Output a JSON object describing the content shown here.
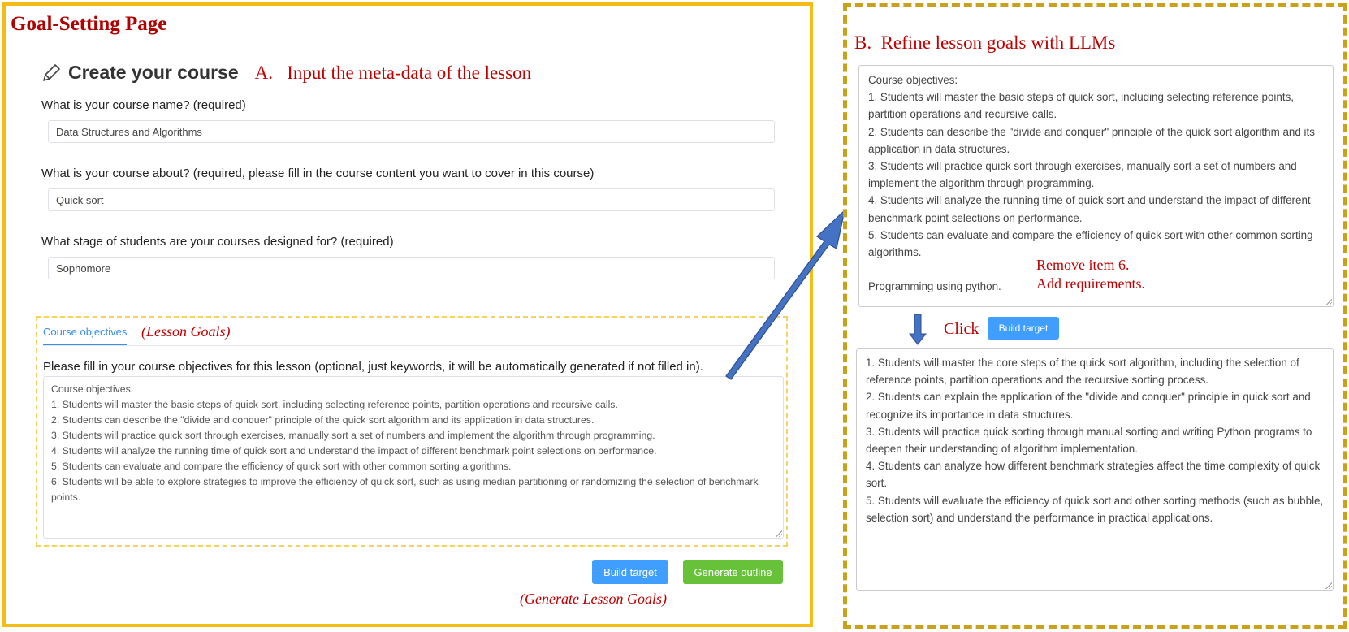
{
  "left": {
    "page_title": "Goal-Setting Page",
    "create_title": "Create your course",
    "annotation_a": "A.   Input the meta-data of the lesson",
    "fields": [
      {
        "label": "What is your course name? (required)",
        "value": "Data Structures and Algorithms"
      },
      {
        "label": "What is your course about? (required, please fill in the course content you want to cover in this course)",
        "value": "Quick sort"
      },
      {
        "label": "What stage of students are your courses designed for? (required)",
        "value": "Sophomore"
      }
    ],
    "tab_label": "Course objectives",
    "annotation_lesson_goals": "(Lesson Goals)",
    "fill_label": "Please fill in your course objectives for this lesson (optional, just keywords, it will be automatically generated if not filled in).",
    "objectives": [
      "Course objectives:",
      "1. Students will master the basic steps of quick sort, including selecting reference points, partition operations and recursive calls.",
      "2. Students can describe the \"divide and conquer\" principle of the quick sort algorithm and its application in data structures.",
      "3. Students will practice quick sort through exercises, manually sort a set of numbers and implement the algorithm through programming.",
      "4. Students will analyze the running time of quick sort and understand the impact of different benchmark point selections on performance.",
      "5. Students can evaluate and compare the efficiency of quick sort with other common sorting algorithms.",
      "6. Students will be able to explore strategies to improve the efficiency of quick sort, such as using median partitioning or randomizing the selection of benchmark points."
    ],
    "build_target_label": "Build target",
    "generate_outline_label": "Generate outline",
    "annotation_generate": "(Generate Lesson Goals)"
  },
  "right": {
    "annotation_b": "B.  Refine lesson goals with LLMs",
    "input_lines": [
      "Course objectives:",
      "1. Students will master the basic steps of quick sort, including selecting reference points, partition operations and recursive calls.",
      "2. Students can describe the \"divide and conquer\" principle of the quick sort algorithm and its application in data structures.",
      "3. Students will practice quick sort through exercises, manually sort a set of numbers and implement the algorithm through programming.",
      "4. Students will analyze the running time of quick sort and understand the impact of different benchmark point selections on performance.",
      "5. Students can evaluate and compare the efficiency of quick sort with other common sorting algorithms.",
      "",
      "Programming using python."
    ],
    "annotation_remove": "Remove item 6.",
    "annotation_add": "Add requirements.",
    "annotation_click": "Click",
    "build_target_label": "Build target",
    "output_lines": [
      "1. Students will master the core steps of the quick sort algorithm, including the selection of reference points, partition operations and the recursive sorting process.",
      "2. Students can explain the application of the \"divide and conquer\" principle in quick sort and recognize its importance in data structures.",
      "3. Students will practice quick sorting through manual sorting and writing Python programs to deepen their understanding of algorithm implementation.",
      "4. Students can analyze how different benchmark strategies affect the time complexity of quick sort.",
      "5. Students will evaluate the efficiency of quick sort and other sorting methods (such as bubble, selection sort) and understand the performance in practical applications."
    ]
  },
  "colors": {
    "annotation_red": "#c00000",
    "left_border": "#f5bc16",
    "right_border": "#c9a21a",
    "button_blue": "#409eff",
    "button_green": "#67c23a",
    "arrow_blue": "#4472c4"
  }
}
